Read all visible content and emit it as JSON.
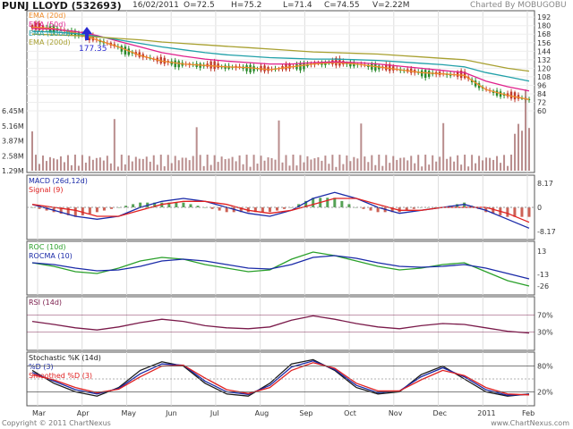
{
  "header": {
    "title": "PUNJ LLOYD (532693)",
    "date": "16/02/2011",
    "open": "O=72.5",
    "high": "H=75.2",
    "low": "L=71.4",
    "close": "C=74.55",
    "volume": "V=2.22M",
    "credit": "Charted By MOBUGOBU"
  },
  "footer": {
    "copyright": "Copyright © 2011 ChartNexus",
    "brand": "www.ChartNexus.com"
  },
  "months": [
    "Mar",
    "Apr",
    "May",
    "Jun",
    "Jul",
    "Aug",
    "Sep",
    "Oct",
    "Nov",
    "Dec",
    "2011",
    "Feb"
  ],
  "colors": {
    "bull": "#2a8a2a",
    "bear": "#c0392b",
    "ema20": "#f08c2a",
    "ema50": "#e0208c",
    "ema100": "#20a0a8",
    "ema200": "#a8a030",
    "macd": "#1a2aa8",
    "signal": "#e02020",
    "roc": "#2aa02a",
    "rocma": "#1a2aa8",
    "rsi": "#7a1a4a",
    "stochK": "#1a1a1a",
    "stochD": "#1a2aa8",
    "smoothD": "#e02020",
    "volume": "#a87070",
    "marker": "#2a2ad0"
  },
  "chart_data": [
    {
      "type": "line",
      "panel": "price",
      "series": [
        {
          "name": "EMA (20d)",
          "values": [
            178,
            176,
            170,
            160,
            150,
            138,
            130,
            126,
            124,
            122,
            121,
            118,
            122,
            126,
            128,
            126,
            122,
            118,
            114,
            112,
            110,
            90,
            82,
            76
          ]
        },
        {
          "name": "EMA (50d)",
          "values": [
            176,
            175,
            172,
            166,
            158,
            150,
            142,
            137,
            133,
            130,
            128,
            126,
            126,
            128,
            129,
            128,
            126,
            123,
            120,
            117,
            114,
            102,
            94,
            88
          ]
        },
        {
          "name": "EMA (100d)",
          "values": [
            172,
            171,
            169,
            165,
            160,
            155,
            150,
            146,
            142,
            139,
            137,
            135,
            134,
            133,
            133,
            132,
            131,
            129,
            127,
            125,
            122,
            114,
            108,
            102
          ]
        },
        {
          "name": "EMA (200d)",
          "values": [
            168,
            167,
            166,
            164,
            162,
            160,
            157,
            155,
            153,
            151,
            149,
            147,
            145,
            143,
            142,
            141,
            140,
            138,
            136,
            134,
            132,
            126,
            120,
            116
          ]
        }
      ],
      "yticks": [
        60,
        72,
        84,
        96,
        108,
        120,
        132,
        144,
        156,
        168,
        180,
        192
      ],
      "ylim": [
        50,
        196
      ],
      "annotation": "177.35",
      "volume_ticks": [
        "6.45M",
        "5.16M",
        "3.87M",
        "2.58M",
        "1.29M"
      ]
    },
    {
      "type": "line",
      "panel": "macd",
      "series": [
        {
          "name": "MACD (26d,12d)",
          "values": [
            1,
            -1,
            -3,
            -4,
            -3,
            0,
            2,
            3,
            2,
            0,
            -2,
            -3,
            -1,
            3,
            5,
            3,
            0,
            -2,
            -1,
            0,
            1,
            -1,
            -4,
            -7
          ]
        },
        {
          "name": "Signal (9)",
          "values": [
            1,
            0,
            -1,
            -3,
            -3,
            -1,
            1,
            2,
            2,
            1,
            -1,
            -2,
            -1,
            1,
            3,
            3,
            1,
            -1,
            -1,
            0,
            0,
            0,
            -2,
            -5
          ]
        }
      ],
      "yticks": [
        "8.17",
        "0",
        "-8.17"
      ]
    },
    {
      "type": "line",
      "panel": "roc",
      "series": [
        {
          "name": "ROC (10d)",
          "values": [
            0,
            -4,
            -10,
            -12,
            -6,
            2,
            6,
            4,
            -2,
            -6,
            -10,
            -8,
            4,
            12,
            8,
            2,
            -4,
            -8,
            -6,
            -2,
            0,
            -10,
            -20,
            -26
          ]
        },
        {
          "name": "ROCMA (10)",
          "values": [
            0,
            -2,
            -6,
            -9,
            -8,
            -4,
            2,
            4,
            2,
            -2,
            -6,
            -7,
            -2,
            6,
            8,
            5,
            0,
            -4,
            -5,
            -4,
            -2,
            -6,
            -12,
            -18
          ]
        }
      ],
      "yticks": [
        "13",
        "-13",
        "-26"
      ]
    },
    {
      "type": "line",
      "panel": "rsi",
      "series": [
        {
          "name": "RSI (14d)",
          "values": [
            55,
            48,
            40,
            35,
            42,
            52,
            60,
            55,
            45,
            40,
            38,
            42,
            58,
            68,
            60,
            50,
            42,
            38,
            45,
            50,
            48,
            40,
            32,
            28
          ]
        }
      ],
      "yticks": [
        "70%",
        "30%"
      ]
    },
    {
      "type": "line",
      "panel": "stochastic",
      "series": [
        {
          "name": "Stochastic %K (14d)",
          "values": [
            70,
            40,
            20,
            10,
            30,
            70,
            90,
            80,
            40,
            15,
            10,
            40,
            85,
            95,
            70,
            30,
            15,
            20,
            60,
            80,
            50,
            20,
            10,
            15
          ]
        },
        {
          "name": "%D (3)",
          "values": [
            65,
            45,
            25,
            15,
            28,
            62,
            85,
            82,
            45,
            20,
            14,
            35,
            78,
            92,
            72,
            35,
            18,
            22,
            55,
            76,
            55,
            25,
            12,
            14
          ]
        },
        {
          "name": "Smoothed %D (3)",
          "values": [
            60,
            48,
            30,
            18,
            26,
            55,
            80,
            82,
            52,
            25,
            16,
            30,
            70,
            88,
            75,
            40,
            22,
            22,
            48,
            70,
            58,
            30,
            15,
            13
          ]
        }
      ],
      "yticks": [
        "80%",
        "20%"
      ]
    }
  ]
}
